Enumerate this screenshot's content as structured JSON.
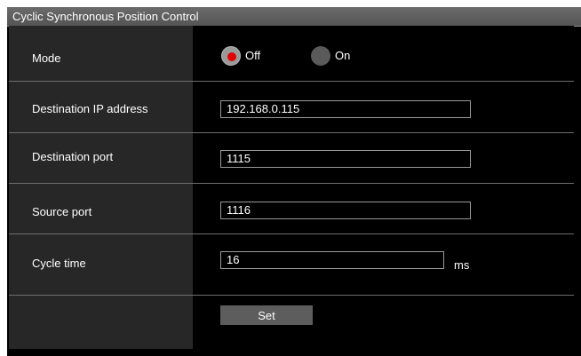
{
  "panel": {
    "title": "Cyclic Synchronous Position Control"
  },
  "mode": {
    "label": "Mode",
    "options": [
      {
        "label": "Off",
        "selected": true
      },
      {
        "label": "On",
        "selected": false
      }
    ]
  },
  "destination_ip": {
    "label": "Destination IP address",
    "value": "192.168.0.115"
  },
  "destination_port": {
    "label": "Destination port",
    "value": "1115"
  },
  "source_port": {
    "label": "Source port",
    "value": "1116"
  },
  "cycle_time": {
    "label": "Cycle time",
    "value": "16",
    "unit": "ms"
  },
  "actions": {
    "set_label": "Set"
  },
  "colors": {
    "radio_selected_dot": "#e00000",
    "label_column_bg": "#272727",
    "title_bar_bg": "#5f5f5f"
  }
}
